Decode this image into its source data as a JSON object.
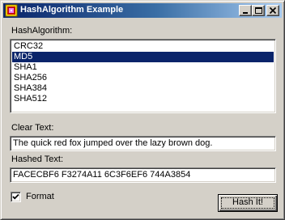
{
  "window": {
    "title": "HashAlgorithm Example",
    "icon": "app-icon"
  },
  "form": {
    "hash_algorithm_label": "HashAlgorithm:",
    "algorithms": [
      "CRC32",
      "MD5",
      "SHA1",
      "SHA256",
      "SHA384",
      "SHA512"
    ],
    "selected_algorithm": "MD5",
    "clear_text_label": "Clear Text:",
    "clear_text_value": "The quick red fox jumped over the lazy brown dog.",
    "hashed_text_label": "Hashed Text:",
    "hashed_text_value": "FACECBF6 F3274A11 6C3F6EF6 744A3854",
    "format_label": "Format",
    "format_checked": true,
    "hash_button_label": "Hash It!"
  },
  "colors": {
    "selection": "#0a246a",
    "titlebar_start": "#0a246a",
    "titlebar_end": "#a6caf0",
    "face": "#d4d0c8"
  }
}
